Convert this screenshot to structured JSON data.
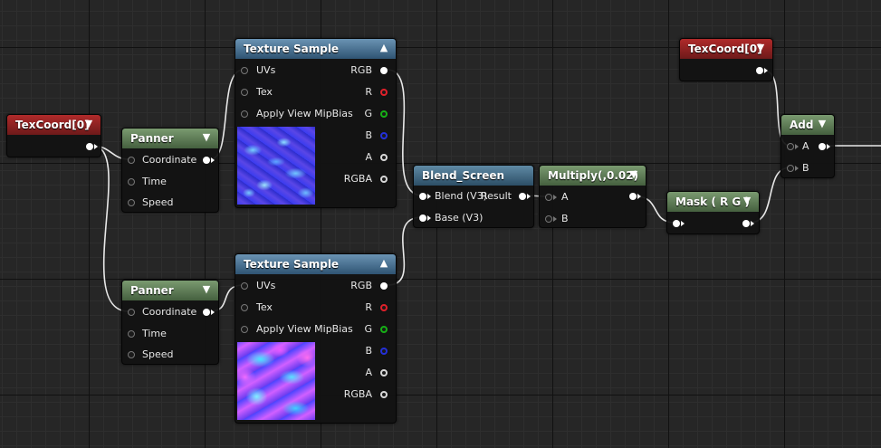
{
  "nodes": {
    "texcoord_left": {
      "title": "TexCoord[0]"
    },
    "panner_top": {
      "title": "Panner",
      "inputs": [
        "Coordinate",
        "Time",
        "Speed"
      ]
    },
    "panner_bottom": {
      "title": "Panner",
      "inputs": [
        "Coordinate",
        "Time",
        "Speed"
      ]
    },
    "texture_sample_top": {
      "title": "Texture Sample",
      "inputs": [
        "UVs",
        "Tex",
        "Apply View MipBias"
      ],
      "outputs": [
        "RGB",
        "R",
        "G",
        "B",
        "A",
        "RGBA"
      ]
    },
    "texture_sample_bottom": {
      "title": "Texture Sample",
      "inputs": [
        "UVs",
        "Tex",
        "Apply View MipBias"
      ],
      "outputs": [
        "RGB",
        "R",
        "G",
        "B",
        "A",
        "RGBA"
      ]
    },
    "blend_screen": {
      "title": "Blend_Screen",
      "inputs": [
        "Blend (V3)",
        "Base (V3)"
      ],
      "output": "Result"
    },
    "multiply": {
      "title": "Multiply(,0.02)",
      "inputs": [
        "A",
        "B"
      ]
    },
    "mask": {
      "title": "Mask ( R G )"
    },
    "texcoord_right": {
      "title": "TexCoord[0]"
    },
    "add": {
      "title": "Add",
      "inputs": [
        "A",
        "B"
      ]
    }
  },
  "icons": {
    "collapse": "triangle-down",
    "expand": "triangle-up"
  },
  "colors": {
    "background": "#262626",
    "header_red": "#8f2222",
    "header_green": "#5a7a52",
    "header_blue": "#3f6a8c",
    "wire": "#ffffff",
    "pin_r": "#e0202a",
    "pin_g": "#16b016",
    "pin_b": "#2430d8"
  }
}
